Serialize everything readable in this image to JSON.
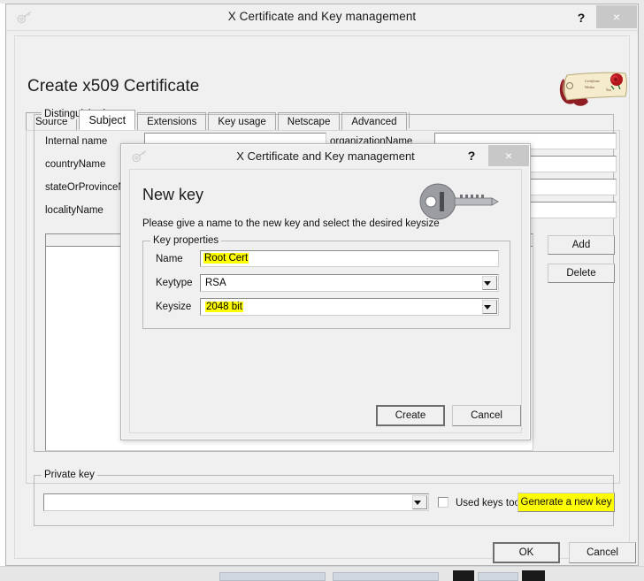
{
  "main_window": {
    "title": "X Certificate and Key management",
    "icon": "key-icon",
    "help_label": "?",
    "close_label": "×",
    "page_title": "Create x509 Certificate",
    "logo": "certificate-scroll-icon",
    "tabs": [
      {
        "label": "Source",
        "active": false
      },
      {
        "label": "Subject",
        "active": true
      },
      {
        "label": "Extensions",
        "active": false
      },
      {
        "label": "Key usage",
        "active": false
      },
      {
        "label": "Netscape",
        "active": false
      },
      {
        "label": "Advanced",
        "active": false
      }
    ],
    "distinguished_name": {
      "group_label": "Distinguished name",
      "left_fields": [
        {
          "label": "Internal name",
          "value": ""
        },
        {
          "label": "countryName",
          "value": ""
        },
        {
          "label": "stateOrProvinceName",
          "value": ""
        },
        {
          "label": "localityName",
          "value": ""
        }
      ],
      "right_fields": [
        {
          "label": "organizationName",
          "value": ""
        },
        {
          "label": "",
          "value": ""
        },
        {
          "label": "",
          "value": ""
        },
        {
          "label": "",
          "value": ""
        }
      ],
      "add_button": "Add",
      "delete_button": "Delete"
    },
    "private_key": {
      "group_label": "Private key",
      "combo_value": "",
      "used_keys_label": "Used keys too",
      "used_keys_checked": false,
      "generate_button": "Generate a new key",
      "generate_highlighted": true
    },
    "footer": {
      "ok_label": "OK",
      "cancel_label": "Cancel"
    }
  },
  "dialog": {
    "title": "X Certificate and Key management",
    "icon": "key-icon",
    "help_label": "?",
    "close_label": "×",
    "heading": "New key",
    "subtitle": "Please give a name to the new key and select the desired keysize",
    "illustration": "large-key-icon",
    "key_properties": {
      "group_label": "Key properties",
      "name_label": "Name",
      "name_value": "Root Cert",
      "name_highlighted": true,
      "keytype_label": "Keytype",
      "keytype_value": "RSA",
      "keysize_label": "Keysize",
      "keysize_value": "2048 bit",
      "keysize_highlighted": true
    },
    "create_button": "Create",
    "cancel_button": "Cancel"
  },
  "colors": {
    "highlight": "#ffff00",
    "window_bg": "#f0f0f0",
    "close_button": "#c8c8c8"
  }
}
